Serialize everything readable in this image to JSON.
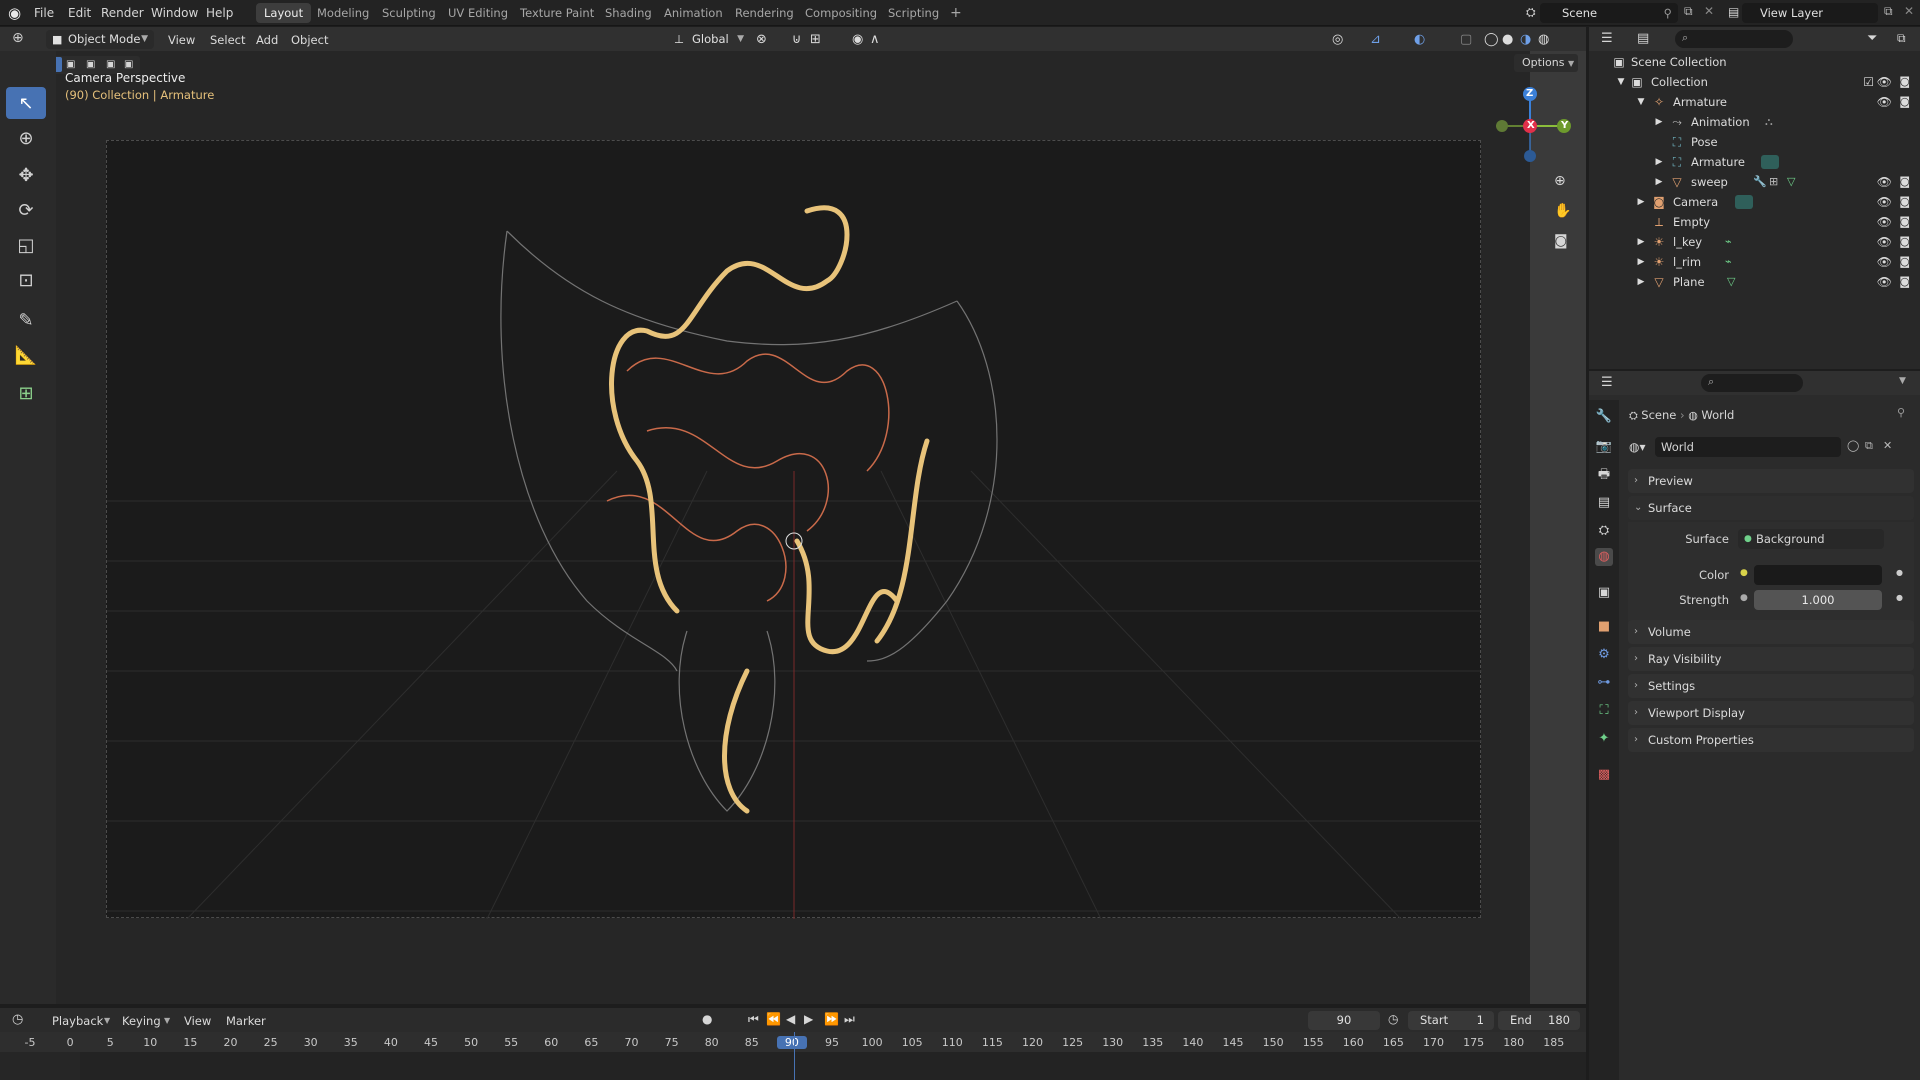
{
  "topbar": {
    "menus": [
      "File",
      "Edit",
      "Render",
      "Window",
      "Help"
    ],
    "workspaces": [
      "Layout",
      "Modeling",
      "Sculpting",
      "UV Editing",
      "Texture Paint",
      "Shading",
      "Animation",
      "Rendering",
      "Compositing",
      "Scripting"
    ],
    "active_workspace": "Layout",
    "add_tab": "+",
    "scene_name": "Scene",
    "view_layer_name": "View Layer"
  },
  "viewport_header": {
    "mode": "Object Mode",
    "menus": [
      "View",
      "Select",
      "Add",
      "Object"
    ],
    "transform_orientation": "Global",
    "options_label": "Options"
  },
  "viewport": {
    "camera_label": "Camera Perspective",
    "context_label": "(90) Collection | Armature",
    "gizmo_axes": [
      "Z",
      "X",
      "Y"
    ],
    "accent_color": "#e5c07b"
  },
  "outliner": {
    "root": "Scene Collection",
    "items": [
      {
        "label": "Collection",
        "icon": "collection-icon"
      },
      {
        "label": "Armature",
        "icon": "armature-icon"
      },
      {
        "label": "Animation",
        "icon": "animation-icon"
      },
      {
        "label": "Pose",
        "icon": "pose-icon"
      },
      {
        "label": "Armature",
        "icon": "armature-data-icon"
      },
      {
        "label": "sweep",
        "icon": "mesh-icon"
      },
      {
        "label": "Camera",
        "icon": "camera-icon"
      },
      {
        "label": "Empty",
        "icon": "empty-icon"
      },
      {
        "label": "l_key",
        "icon": "light-icon"
      },
      {
        "label": "l_rim",
        "icon": "light-icon"
      },
      {
        "label": "Plane",
        "icon": "mesh-icon"
      }
    ]
  },
  "properties": {
    "breadcrumb_scene": "Scene",
    "breadcrumb_world": "World",
    "world_name": "World",
    "panels": {
      "preview": "Preview",
      "surface": "Surface",
      "volume": "Volume",
      "ray_visibility": "Ray Visibility",
      "settings": "Settings",
      "viewport_display": "Viewport Display",
      "custom_properties": "Custom Properties"
    },
    "surface_label": "Surface",
    "surface_value": "Background",
    "color_label": "Color",
    "strength_label": "Strength",
    "strength_value": "1.000"
  },
  "timeline": {
    "menus": [
      "Playback",
      "Keying",
      "View",
      "Marker"
    ],
    "current_frame": "90",
    "start_label": "Start",
    "start_value": "1",
    "end_label": "End",
    "end_value": "180",
    "ticks": [
      "-5",
      "0",
      "5",
      "10",
      "15",
      "20",
      "25",
      "30",
      "35",
      "40",
      "45",
      "50",
      "55",
      "60",
      "65",
      "70",
      "75",
      "80",
      "85",
      "90",
      "95",
      "100",
      "105",
      "110",
      "115",
      "120",
      "125",
      "130",
      "135",
      "140",
      "145",
      "150",
      "155",
      "160",
      "165",
      "170",
      "175",
      "180",
      "185"
    ]
  }
}
